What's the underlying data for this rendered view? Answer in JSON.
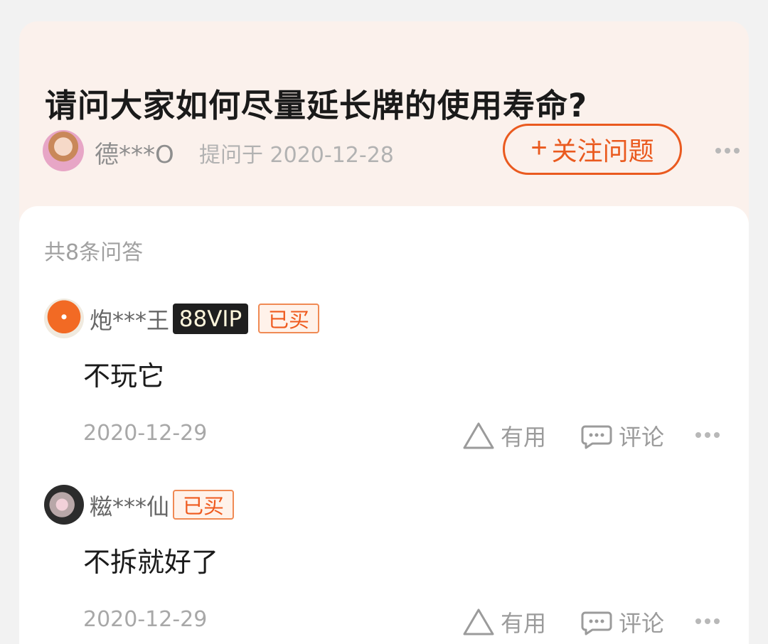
{
  "question": {
    "title": "请问大家如何尽量延长牌的使用寿命?",
    "asker_name": "德***O",
    "asked_at": "提问于 2020-12-28",
    "follow_label": "关注问题"
  },
  "answers_header": {
    "count_text": "共8条问答"
  },
  "answers": [
    {
      "user": "炮***王",
      "vip_label": "88VIP",
      "bought_label": "已买",
      "text": "不玩它",
      "date": "2020-12-29",
      "useful_label": "有用",
      "comment_label": "评论"
    },
    {
      "user": "糍***仙",
      "bought_label": "已买",
      "text": "不拆就好了",
      "date": "2020-12-29",
      "useful_label": "有用",
      "comment_label": "评论"
    }
  ],
  "icons": {
    "asker_avatar": "avatar-icon",
    "follow": "plus-icon",
    "more": "more-icon",
    "useful": "triangle-up-icon",
    "comment": "comment-icon"
  },
  "colors": {
    "accent": "#ea5a1f",
    "question_background": "#fbf1ec",
    "vip_background": "#1f1f1f"
  }
}
